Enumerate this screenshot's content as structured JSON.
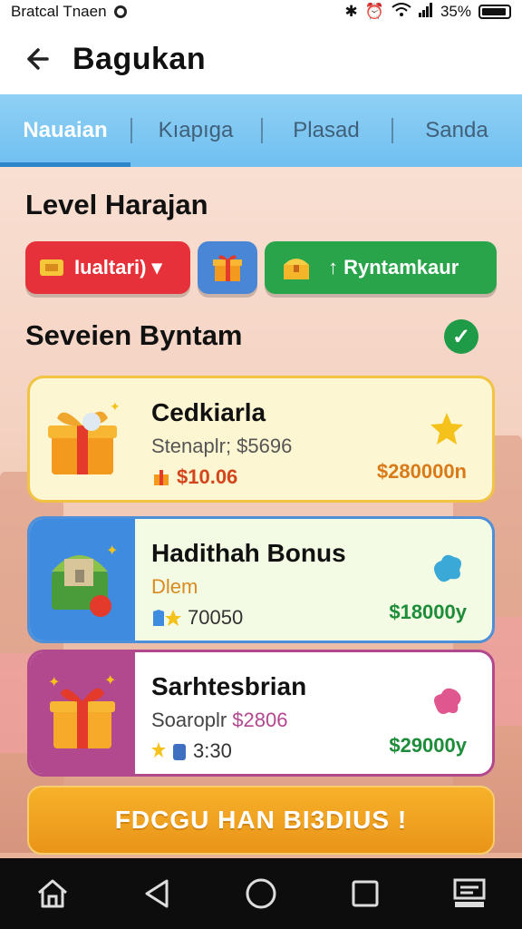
{
  "status_bar": {
    "left_text": "Bratcal Tnaen",
    "battery": "35%"
  },
  "app_bar": {
    "title": "Bagukan"
  },
  "tabs": [
    {
      "label": "Nauaian",
      "active": true
    },
    {
      "label": "Kıapıga",
      "active": false
    },
    {
      "label": "Plasad",
      "active": false
    },
    {
      "label": "Sanda",
      "active": false
    }
  ],
  "level_section": {
    "title": "Level Harajan"
  },
  "chips": [
    {
      "label": "Iualtari) ▾",
      "icon": "coupon-icon",
      "color": "#e7313a"
    },
    {
      "label": "",
      "icon": "gift-icon",
      "color": "#4a86d6"
    },
    {
      "label": "↑ Ryntamkaur",
      "icon": "treasure-icon",
      "color": "#2aa44a"
    }
  ],
  "rewards_section": {
    "title": "Seveien Byntam"
  },
  "cards": [
    {
      "name": "Cedkiarla",
      "subtitle": "Stenaplr; $5696",
      "meta": "$10.06",
      "price": "$280000n"
    },
    {
      "name": "Hadithah Bonus",
      "subtitle": "Dlem",
      "meta": "70050",
      "price": "$18000y"
    },
    {
      "name": "Sarhtesbrian",
      "subtitle_prefix": "Soaroplr ",
      "subtitle_highlight": "$2806",
      "meta": "3:30",
      "price": "$29000y"
    }
  ],
  "cta": {
    "label": "FDCGU HAN BI3DIUS !"
  }
}
